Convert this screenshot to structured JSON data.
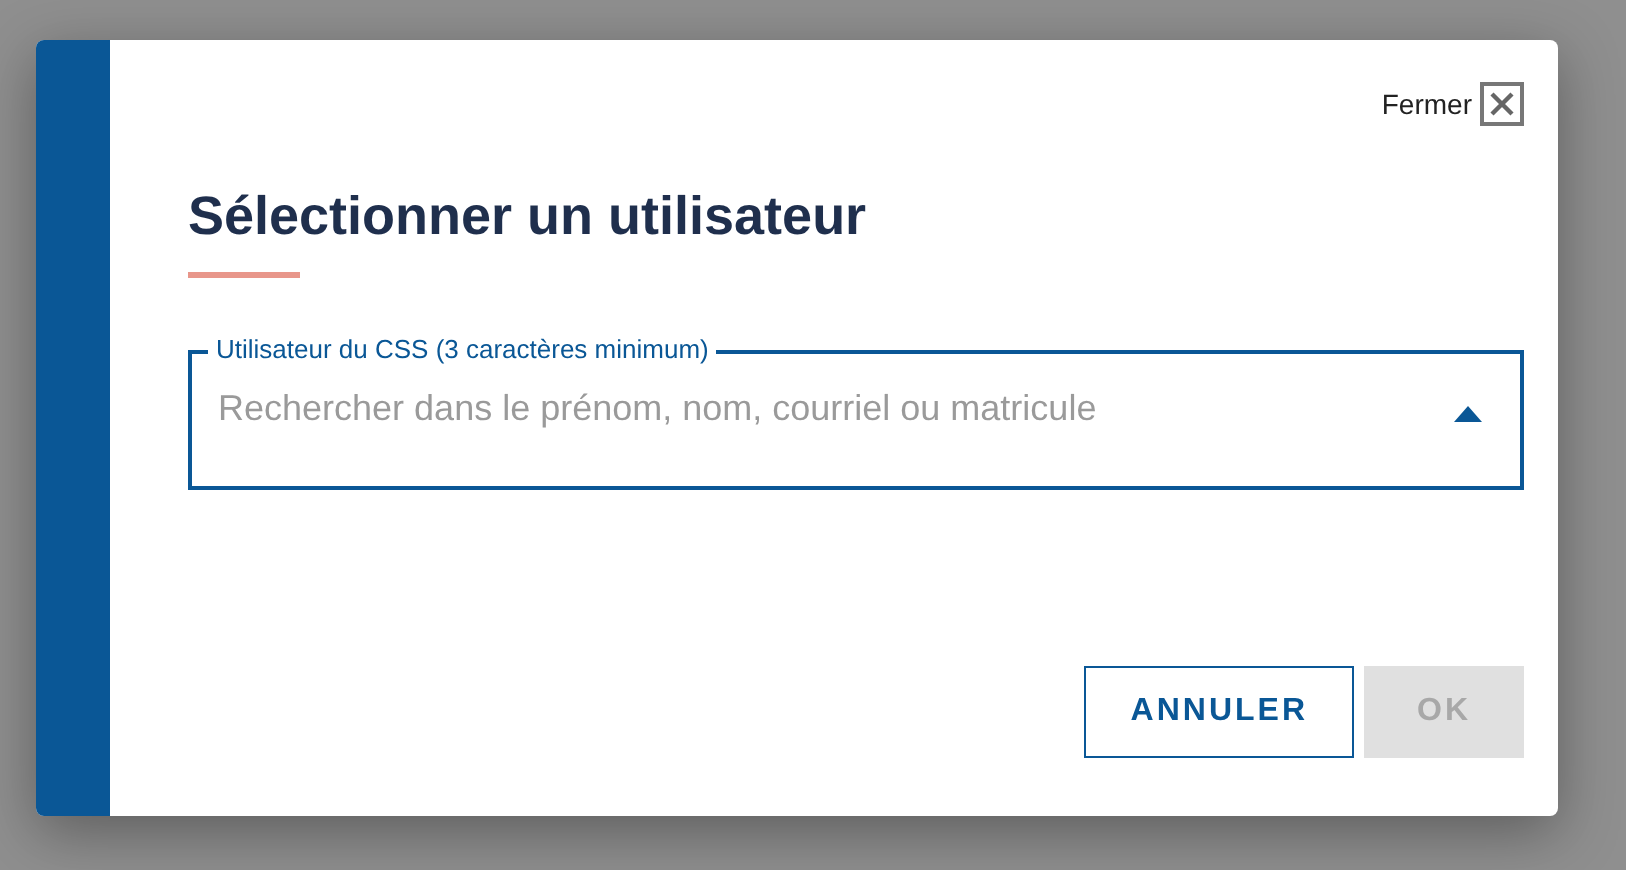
{
  "dialog": {
    "close": {
      "label": "Fermer"
    },
    "title": "Sélectionner un utilisateur",
    "field": {
      "label": "Utilisateur du CSS (3 caractères minimum)",
      "placeholder": "Rechercher dans le prénom, nom, courriel ou matricule",
      "expanded": true
    },
    "buttons": [
      {
        "label": "ANNULER",
        "kind": "outline",
        "disabled": false
      },
      {
        "label": "OK",
        "kind": "primary",
        "disabled": true
      }
    ]
  }
}
